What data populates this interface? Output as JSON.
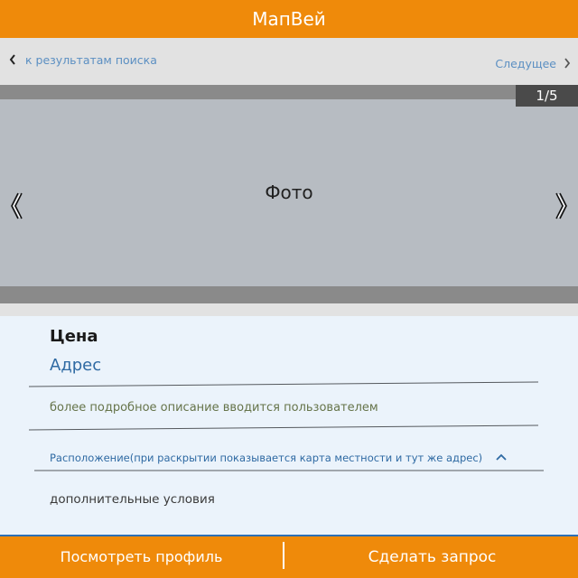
{
  "app": {
    "title": "МапВей"
  },
  "nav": {
    "back_label": "к результатам поиска",
    "next_label": "Следущее"
  },
  "gallery": {
    "photo_label": "Фото",
    "counter": "1/5"
  },
  "listing": {
    "price": "Цена",
    "address": "Адрес",
    "description": "более подробное описание вводится пользователем",
    "location_label": "Расположение(при раскрытии показывается карта местности и тут же адрес)",
    "extra_terms": "дополнительные условия"
  },
  "actions": {
    "view_profile": "Посмотреть профиль",
    "make_request": "Сделать запрос"
  },
  "colors": {
    "brand": "#ef8a0a",
    "link": "#5b8fc2",
    "accent_blue": "#2f6aa3"
  }
}
